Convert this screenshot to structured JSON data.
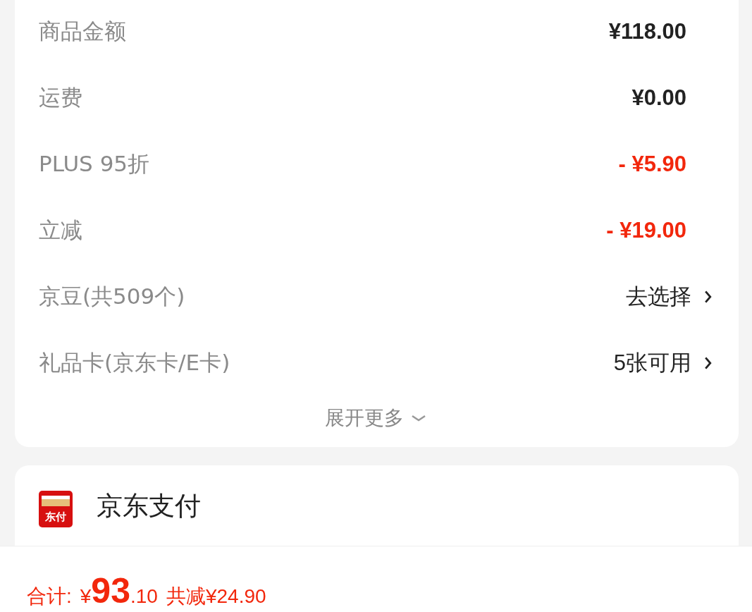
{
  "summary": {
    "rows": [
      {
        "label": "商品金额",
        "value": "¥118.00",
        "kind": "amount"
      },
      {
        "label": "运费",
        "value": "¥0.00",
        "kind": "amount"
      },
      {
        "label": "PLUS 95折",
        "value": "- ¥5.90",
        "kind": "discount"
      },
      {
        "label": "立减",
        "value": "- ¥19.00",
        "kind": "discount"
      },
      {
        "label": "京豆(共509个)",
        "value": "去选择",
        "kind": "link"
      },
      {
        "label": "礼品卡(京东卡/E卡)",
        "value": "5张可用",
        "kind": "link"
      }
    ],
    "expand": "展开更多"
  },
  "payment": {
    "logo_text": "东付",
    "title": "京东支付"
  },
  "footer": {
    "total_label": "合计:",
    "currency": "¥",
    "total_integer": "93",
    "total_decimal": ".10",
    "savings": "共减¥24.90"
  }
}
